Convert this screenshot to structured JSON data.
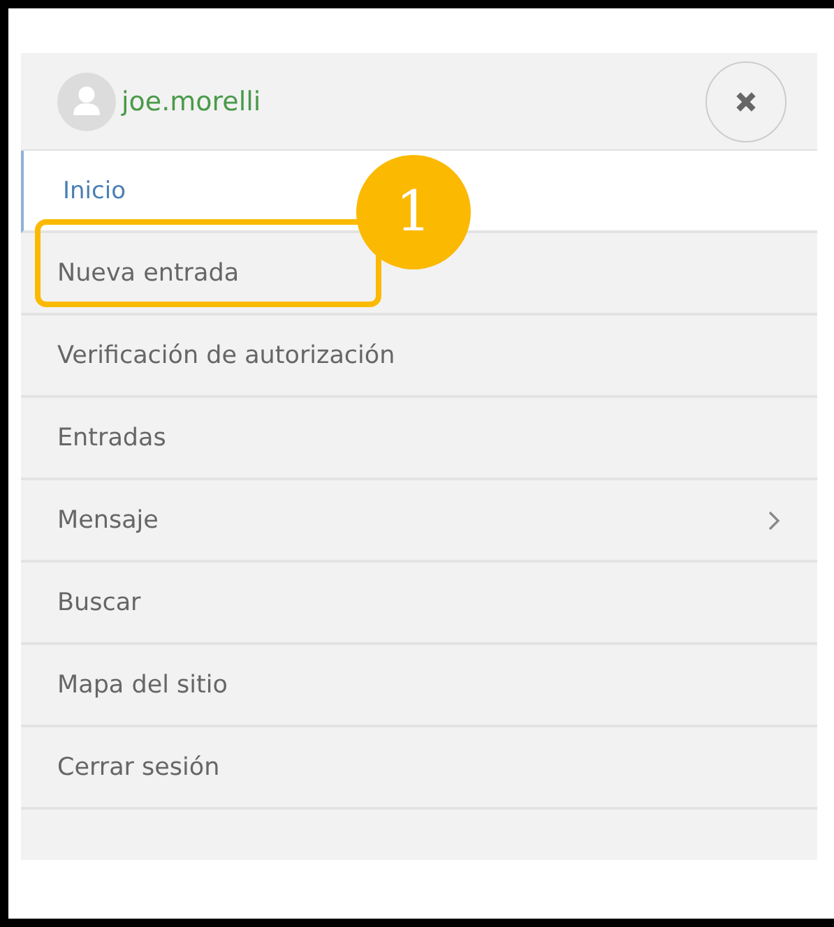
{
  "user": {
    "name": "joe.morelli"
  },
  "menu": [
    {
      "label": "Inicio",
      "selected": true,
      "has_submenu": false,
      "highlighted": false
    },
    {
      "label": "Nueva entrada",
      "selected": false,
      "has_submenu": false,
      "highlighted": true
    },
    {
      "label": "Verificación de autorización",
      "selected": false,
      "has_submenu": false,
      "highlighted": false
    },
    {
      "label": "Entradas",
      "selected": false,
      "has_submenu": false,
      "highlighted": false
    },
    {
      "label": "Mensaje",
      "selected": false,
      "has_submenu": true,
      "highlighted": false
    },
    {
      "label": "Buscar",
      "selected": false,
      "has_submenu": false,
      "highlighted": false
    },
    {
      "label": "Mapa del sitio",
      "selected": false,
      "has_submenu": false,
      "highlighted": false
    },
    {
      "label": "Cerrar sesión",
      "selected": false,
      "has_submenu": false,
      "highlighted": false
    }
  ],
  "callout": {
    "number": "1"
  }
}
